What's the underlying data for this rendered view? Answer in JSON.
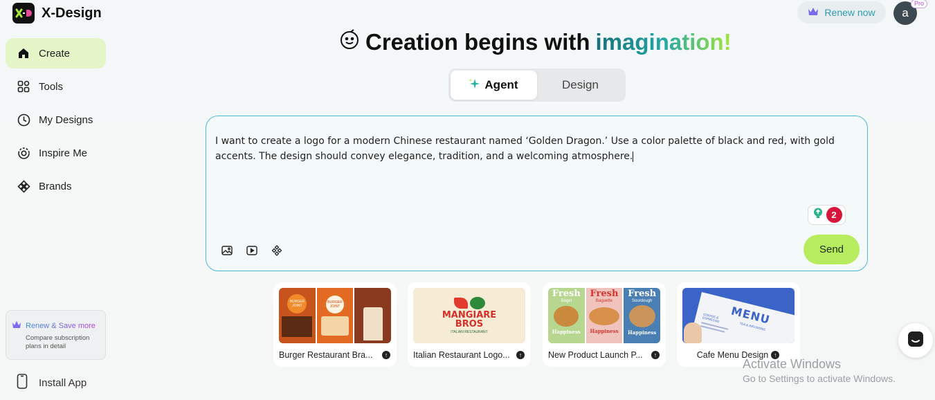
{
  "app": {
    "name": "X-Design"
  },
  "sidebar": {
    "items": [
      {
        "label": "Create",
        "icon": "home-icon",
        "active": true
      },
      {
        "label": "Tools",
        "icon": "tools-grid-icon"
      },
      {
        "label": "My Designs",
        "icon": "clock-icon"
      },
      {
        "label": "Inspire Me",
        "icon": "inspire-icon"
      },
      {
        "label": "Brands",
        "icon": "brands-diamond-icon"
      }
    ],
    "promo": {
      "title": "Renew & Save more",
      "subtitle": "Compare subscription plans in detail"
    },
    "install_label": "Install App"
  },
  "header": {
    "renew_label": "Renew now",
    "avatar_letter": "a",
    "pro_badge": "Pro"
  },
  "hero": {
    "headline_main": "Creation begins with",
    "headline_accent": "imagination!"
  },
  "mode_tabs": [
    {
      "label": "Agent",
      "active": true
    },
    {
      "label": "Design",
      "active": false
    }
  ],
  "prompt": {
    "text": "I want to create a logo for a modern Chinese restaurant named ‘Golden Dragon.’ Use a color palette of black and red, with gold accents. The design should convey elegance, tradition, and a welcoming atmosphere.",
    "hint_count": "2",
    "send_label": "Send"
  },
  "templates": [
    {
      "label": "Burger Restaurant Bra...",
      "image_text": [
        "BURGER JOINT",
        "BURGER JOINT"
      ]
    },
    {
      "label": "Italian Restaurant Logo...",
      "image_text": [
        "MANGIARE",
        "BROS",
        "ITALIAN RESTAURANT"
      ]
    },
    {
      "label": "New Product Launch P...",
      "image_text": [
        "Fresh",
        "Bagel",
        "Happiness",
        "Fresh",
        "Baguette",
        "Happiness",
        "Fresh",
        "Sourdough",
        "Happiness"
      ]
    },
    {
      "label": "Cafe Menu Design",
      "image_text": [
        "MENU",
        "COFFEE & ESPRESSO",
        "TEA & INFUSIONS"
      ]
    }
  ],
  "system_overlay": {
    "line1": "Activate Windows",
    "line2": "Go to Settings to activate Windows."
  },
  "colors": {
    "accent_green": "#b6ec5e",
    "active_nav": "#e4f5c8",
    "prompt_border": "#4fb7d6",
    "renew_text": "#2f9bb3",
    "badge_red": "#d7163b"
  }
}
